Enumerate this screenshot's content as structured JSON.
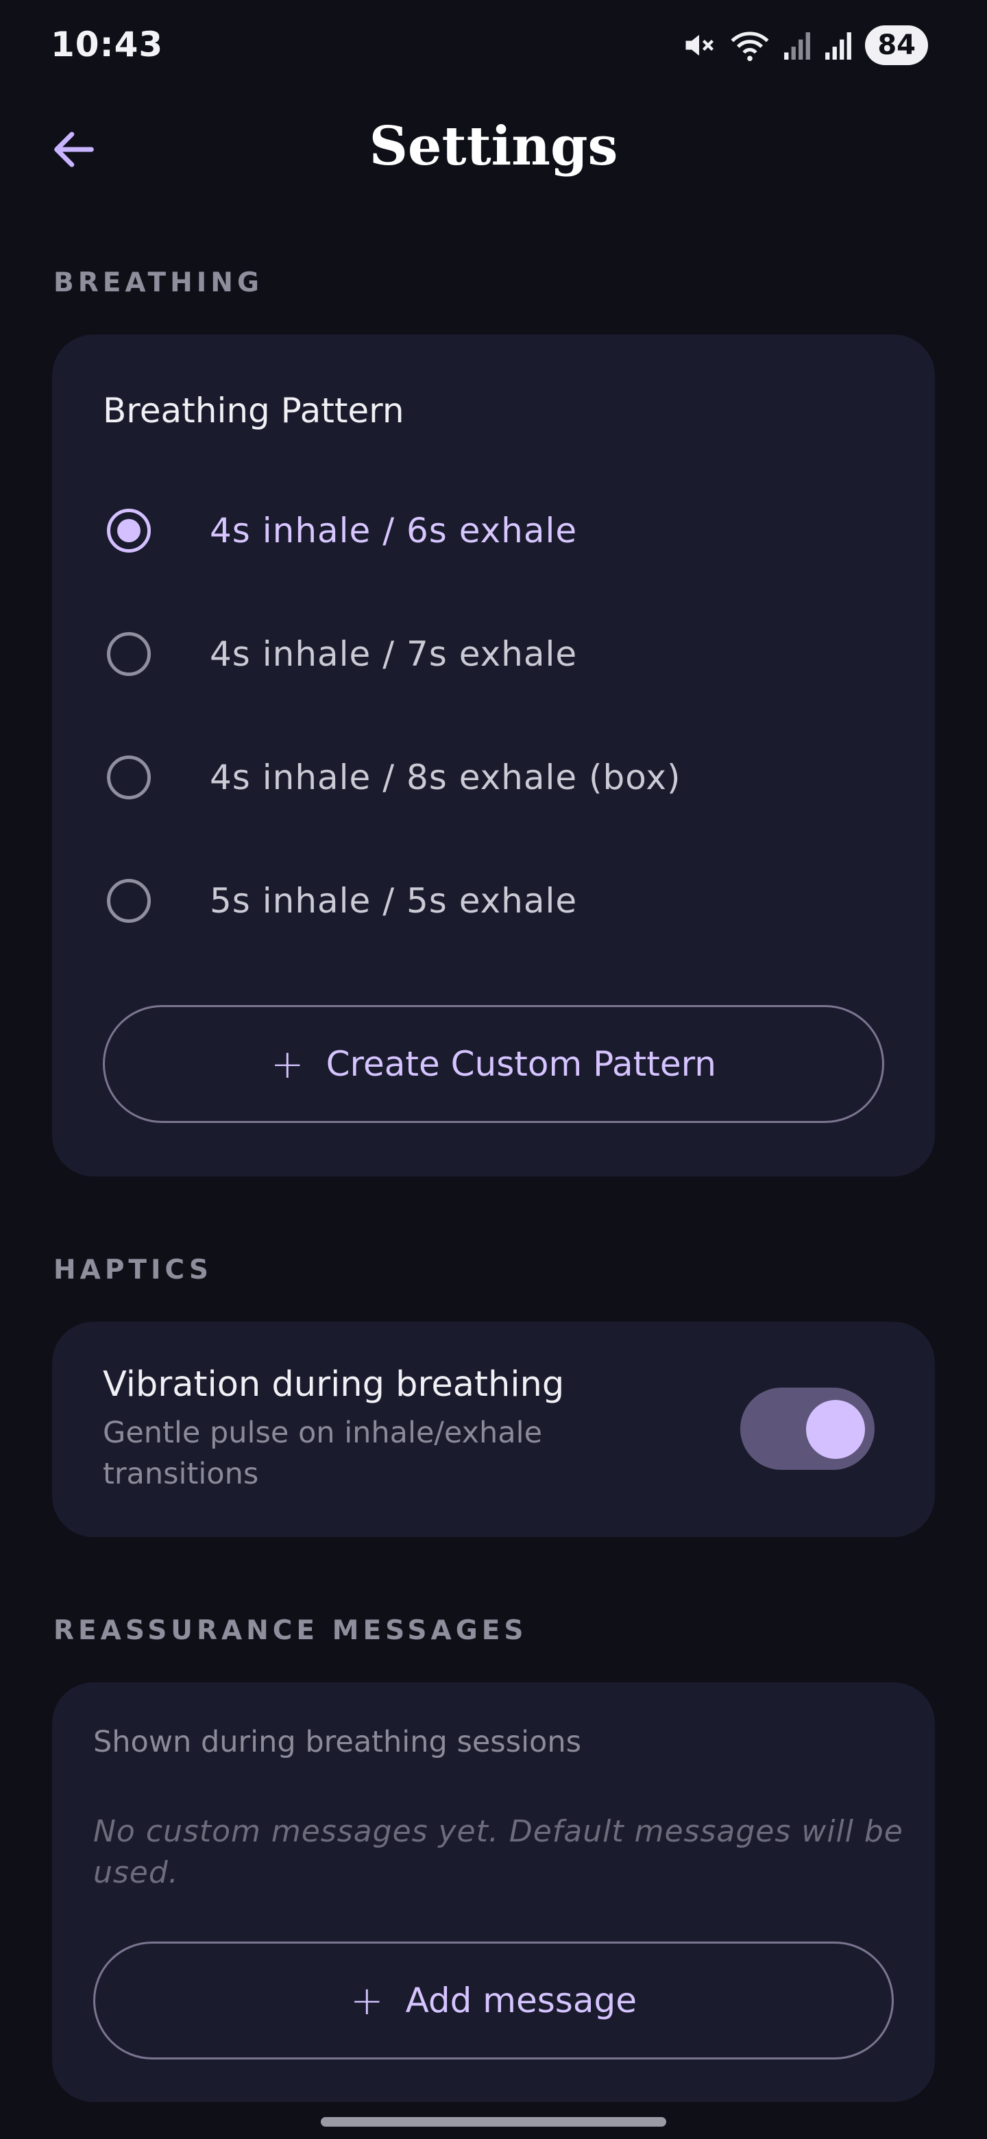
{
  "status_bar": {
    "time": "10:43",
    "battery": "84",
    "icons": [
      "mute-icon",
      "wifi-icon",
      "signal-icon",
      "signal-icon"
    ]
  },
  "header": {
    "title": "Settings",
    "back_icon": "arrow-left-icon"
  },
  "breathing": {
    "section_label": "BREATHING",
    "card_title": "Breathing Pattern",
    "options": [
      {
        "label": "4s inhale / 6s exhale",
        "selected": true
      },
      {
        "label": "4s inhale / 7s exhale",
        "selected": false
      },
      {
        "label": "4s inhale / 8s exhale (box)",
        "selected": false
      },
      {
        "label": "5s inhale / 5s exhale",
        "selected": false
      }
    ],
    "create_button": "Create Custom Pattern"
  },
  "haptics": {
    "section_label": "HAPTICS",
    "title": "Vibration during breathing",
    "subtitle_line1": "Gentle pulse on inhale/exhale",
    "subtitle_line2": "transitions",
    "enabled": true
  },
  "reassurance": {
    "section_label": "REASSURANCE MESSAGES",
    "hint": "Shown during breathing sessions",
    "empty_line1": "No custom messages yet. Default messages will be",
    "empty_line2": "used.",
    "add_button": "Add message"
  },
  "colors": {
    "background": "#0f0f18",
    "card": "#1a1b2d",
    "accent": "#d4c0ff"
  }
}
